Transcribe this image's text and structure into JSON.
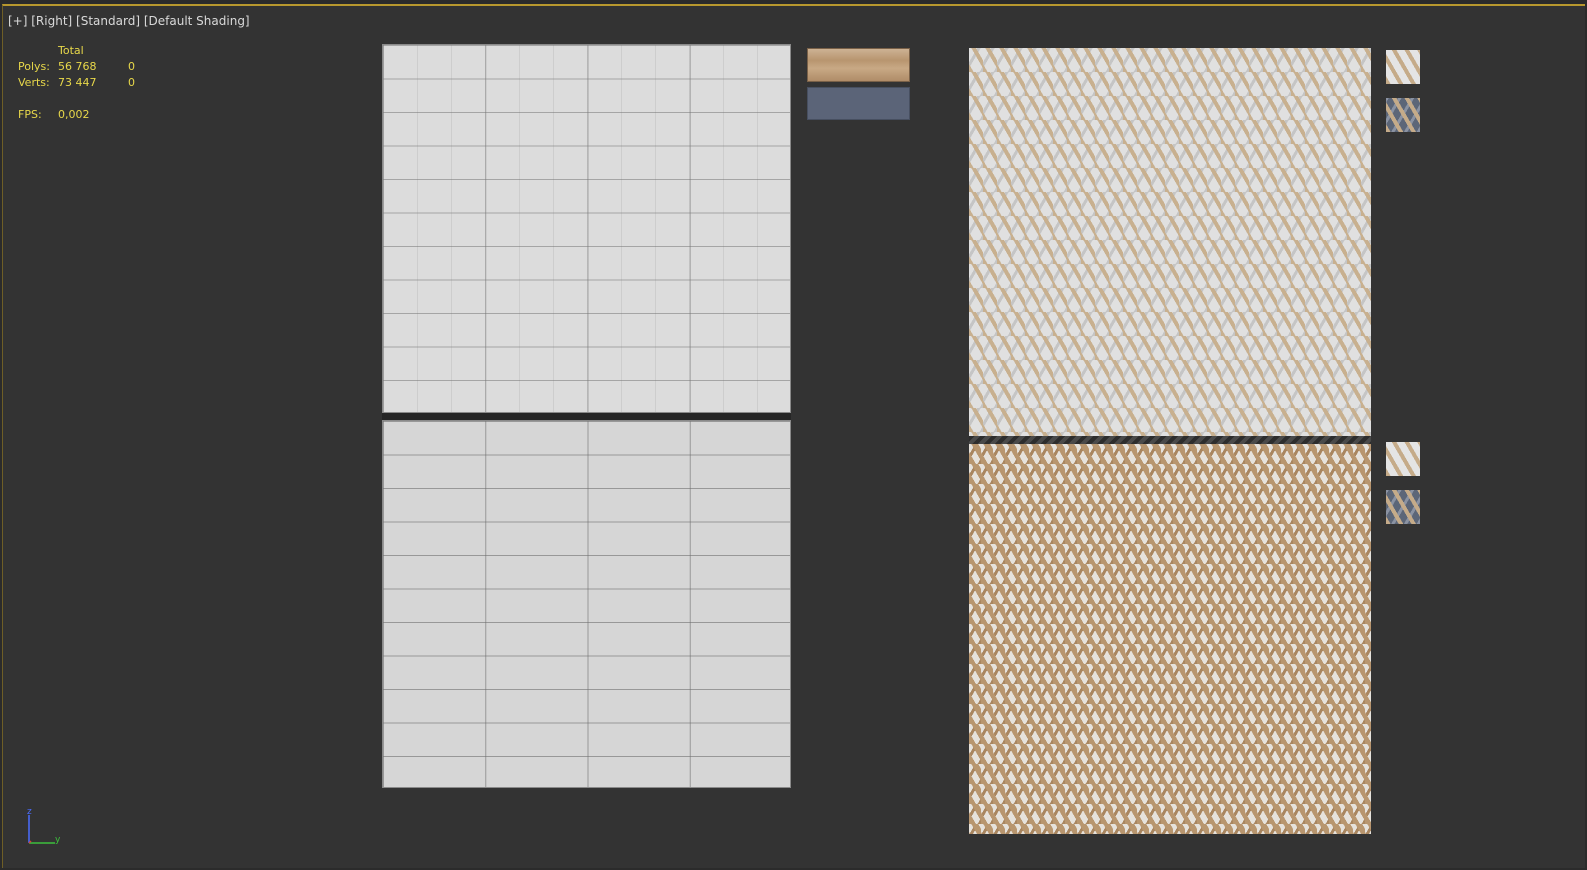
{
  "viewport": {
    "labels": [
      "[+]",
      "[Right]",
      "[Standard]",
      "[Default Shading]"
    ]
  },
  "stats": {
    "header": "Total",
    "polys_label": "Polys:",
    "polys_total": "56 768",
    "polys_sel": "0",
    "verts_label": "Verts:",
    "verts_total": "73 447",
    "verts_sel": "0",
    "fps_label": "FPS:",
    "fps_value": "0,002"
  },
  "axis": {
    "z": "z",
    "y": "y"
  },
  "colors": {
    "viewport_bg": "#333333",
    "active_border": "#b8982e",
    "stats_text": "#e8d84a",
    "wood": "#b8956f",
    "blue_swatch": "#5b6478",
    "axis_z": "#4a6cff",
    "axis_y": "#3cc03c",
    "axis_x": "#d83a3a"
  }
}
